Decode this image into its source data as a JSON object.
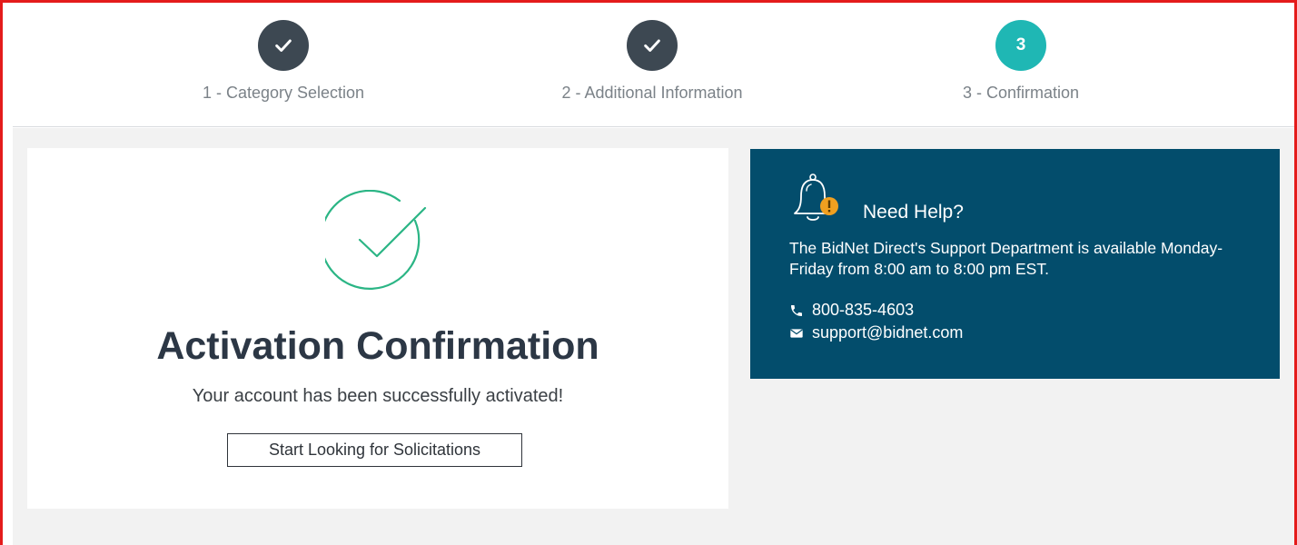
{
  "stepper": {
    "steps": [
      {
        "number": "1",
        "label": "1 - Category Selection",
        "status": "complete"
      },
      {
        "number": "2",
        "label": "2 - Additional Information",
        "status": "complete"
      },
      {
        "number": "3",
        "label": "3 - Confirmation",
        "status": "active"
      }
    ]
  },
  "confirmation": {
    "title": "Activation Confirmation",
    "message": "Your account has been successfully activated!",
    "button_label": "Start Looking for Solicitations",
    "icon": "check-circle-icon"
  },
  "help": {
    "title": "Need Help?",
    "text": "The BidNet Direct's Support Department is available Monday-Friday from 8:00 am to 8:00 pm EST.",
    "phone": "800-835-4603",
    "email": "support@bidnet.com",
    "icon": "bell-alert-icon"
  },
  "colors": {
    "step_complete": "#3d4852",
    "step_active": "#1fb7b4",
    "success_green": "#2bb585",
    "help_panel_bg": "#034d6c",
    "alert_orange": "#f0a020",
    "frame_red": "#e41b1b"
  }
}
